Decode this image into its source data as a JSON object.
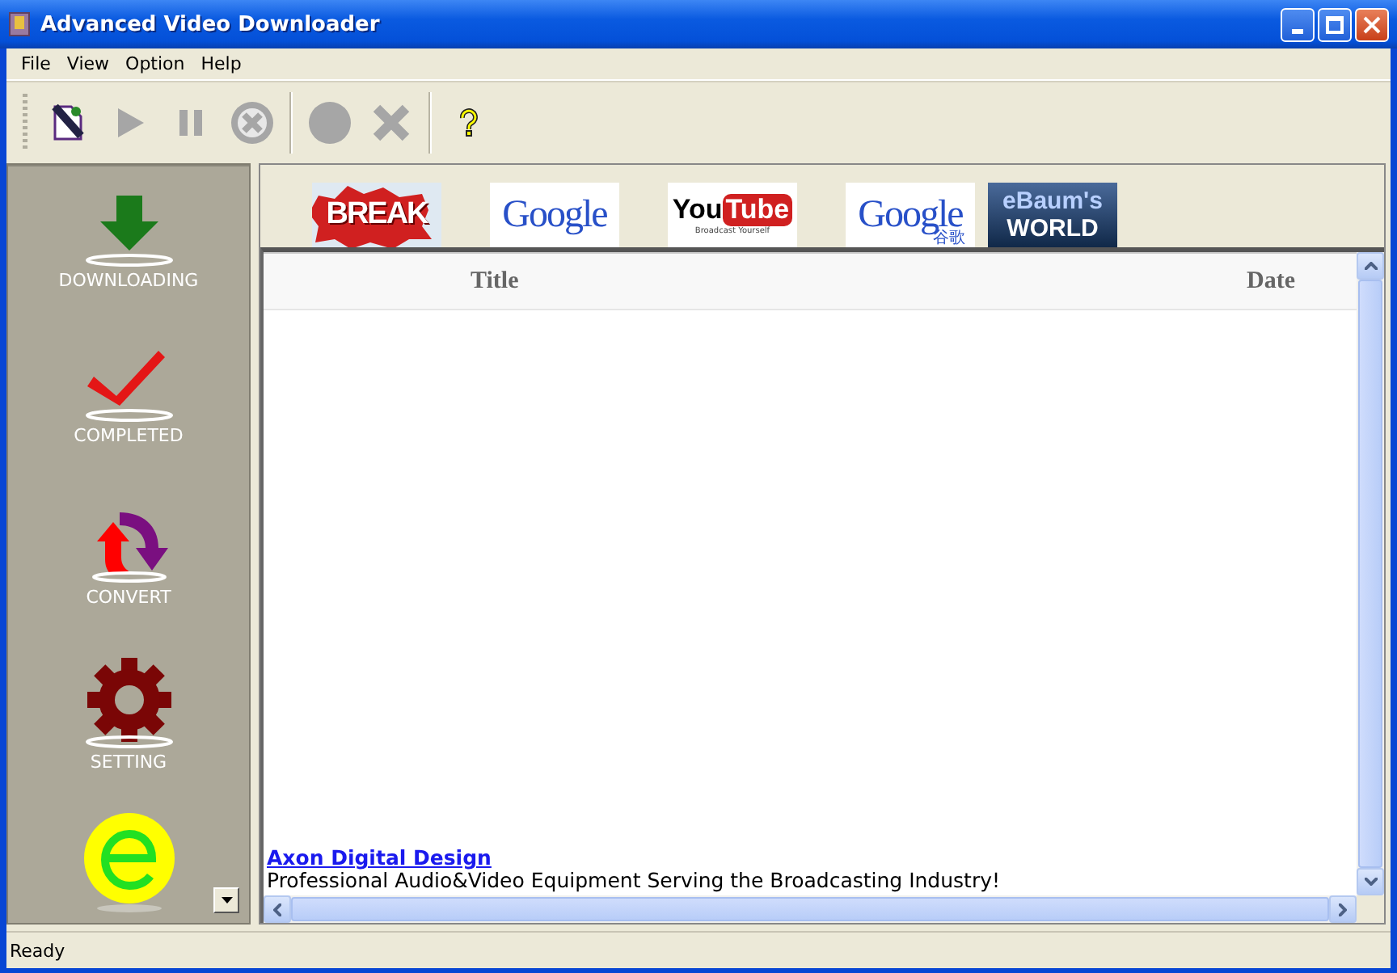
{
  "window": {
    "title": "Advanced Video Downloader"
  },
  "menu": [
    "File",
    "View",
    "Option",
    "Help"
  ],
  "toolbar": [
    {
      "kind": "new",
      "disabled": false
    },
    {
      "kind": "play",
      "disabled": true
    },
    {
      "kind": "pause",
      "disabled": true
    },
    {
      "kind": "cancel",
      "disabled": true
    },
    {
      "kind": "sep"
    },
    {
      "kind": "record",
      "disabled": true
    },
    {
      "kind": "delete",
      "disabled": true
    },
    {
      "kind": "sep"
    },
    {
      "kind": "help",
      "disabled": false
    }
  ],
  "sidebar": {
    "items": [
      {
        "kind": "downloading",
        "label": "DOWNLOADING"
      },
      {
        "kind": "completed",
        "label": "COMPLETED"
      },
      {
        "kind": "convert",
        "label": "CONVERT"
      },
      {
        "kind": "setting",
        "label": "SETTING"
      },
      {
        "kind": "explorer"
      }
    ]
  },
  "sites": [
    {
      "kind": "break",
      "text": "BREAK"
    },
    {
      "kind": "google",
      "text": "Google"
    },
    {
      "kind": "youtube",
      "text": "You",
      "text2": "Tube",
      "sub": "Broadcast Yourself"
    },
    {
      "kind": "google",
      "text": "Google",
      "sub": "谷歌"
    },
    {
      "kind": "ebaum",
      "text": "eBaum's",
      "text2": "WORLD"
    }
  ],
  "table": {
    "columns": [
      "Title",
      "Date"
    ]
  },
  "ad": {
    "link": "Axon Digital Design",
    "text": "Professional Audio&Video Equipment Serving the Broadcasting Industry!"
  },
  "status_bar": "Ready"
}
